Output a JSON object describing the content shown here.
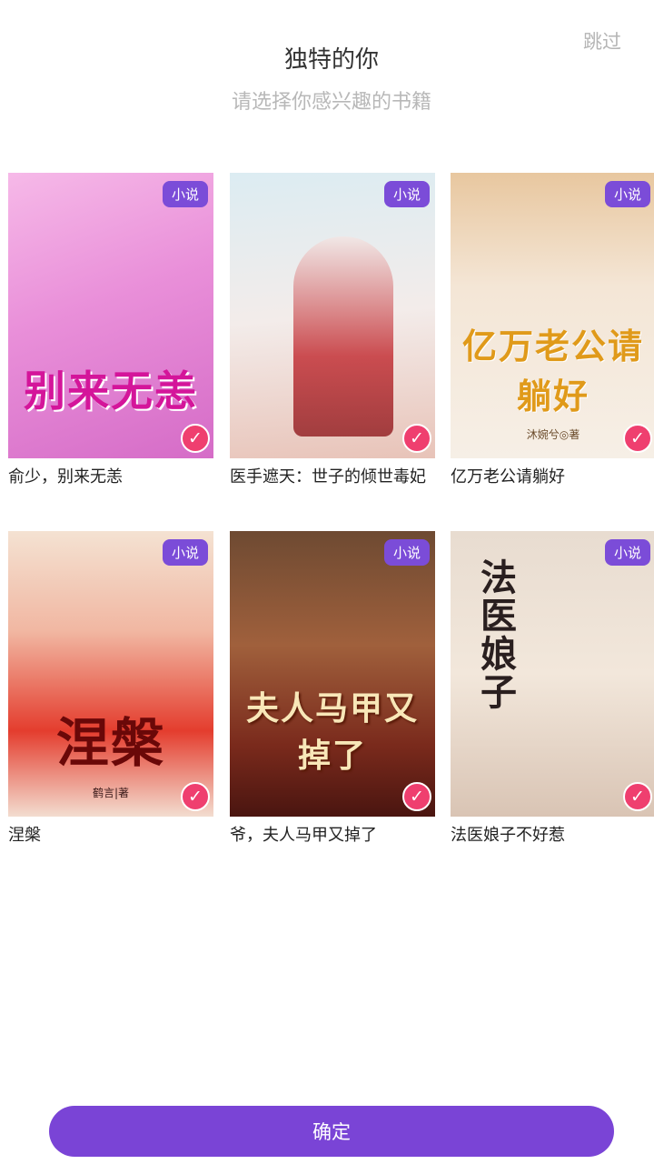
{
  "header": {
    "skip_label": "跳过",
    "title": "独特的你",
    "subtitle": "请选择你感兴趣的书籍"
  },
  "books": [
    {
      "name": "俞少，别来无恙",
      "tag": "小说",
      "cover_title": "别来无恙",
      "cover_author": "",
      "selected": true
    },
    {
      "name": "医手遮天：世子的倾世毒妃",
      "tag": "小说",
      "cover_title": "",
      "cover_author": "",
      "selected": true
    },
    {
      "name": "亿万老公请躺好",
      "tag": "小说",
      "cover_title": "亿万老公请躺好",
      "cover_author": "沐婉兮◎著",
      "selected": true
    },
    {
      "name": "涅槃",
      "tag": "小说",
      "cover_title": "涅槃",
      "cover_author": "鹤言|著",
      "selected": true
    },
    {
      "name": "爷，夫人马甲又掉了",
      "tag": "小说",
      "cover_title": "夫人马甲又掉了",
      "cover_author": "",
      "selected": true
    },
    {
      "name": "法医娘子不好惹",
      "tag": "小说",
      "cover_title": "法医娘子",
      "cover_author": "",
      "selected": true
    }
  ],
  "check_icon": "check-icon",
  "confirm_label": "确定",
  "colors": {
    "accent": "#7a44d6",
    "check": "#ef3f6f"
  }
}
